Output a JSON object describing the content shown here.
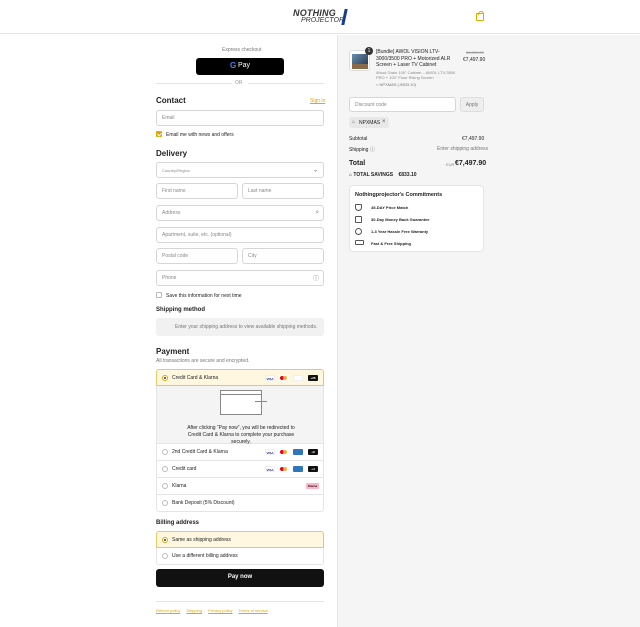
{
  "header": {
    "logo_line1": "NOTHING",
    "logo_line2": "PROJECTOR",
    "bag_icon": "shopping-bag-icon"
  },
  "express": {
    "title": "Express checkout",
    "gpay_g": "G",
    "gpay_label": "Pay",
    "or": "OR"
  },
  "contact": {
    "title": "Contact",
    "sign_in": "Sign in",
    "email_placeholder": "Email",
    "newsletter_label": "Email me with news and offers",
    "newsletter_checked": true
  },
  "delivery": {
    "title": "Delivery",
    "country_placeholder": "Country/Region",
    "first_name": "First name",
    "last_name": "Last name",
    "address": "Address",
    "apartment": "Apartment, suite, etc. (optional)",
    "postal": "Postal code",
    "city": "City",
    "phone": "Phone",
    "save_info": "Save this information for next time"
  },
  "shipping": {
    "title": "Shipping method",
    "message": "Enter your shipping address to view available shipping methods."
  },
  "payment": {
    "title": "Payment",
    "subtitle": "All transactions are secure and encrypted.",
    "options": [
      {
        "label": "Credit Card & Klarna",
        "selected": true
      },
      {
        "label": "2nd Credit Card & Klarna",
        "selected": false
      },
      {
        "label": "Credit card",
        "selected": false
      },
      {
        "label": "Klarna",
        "selected": false
      },
      {
        "label": "Bank Deposit (5% Discount)",
        "selected": false
      }
    ],
    "redirect_text": "After clicking “Pay now”, you will be redirected to Credit Card & Klarna to complete your purchase securely.",
    "badges": {
      "visa": "VISA",
      "more1": "+26",
      "more2": "+8",
      "more3": "+4",
      "klarna": "Klarna"
    }
  },
  "billing": {
    "title": "Billing address",
    "options": [
      {
        "label": "Same as shipping address",
        "selected": true
      },
      {
        "label": "Use a different billing address",
        "selected": false
      }
    ]
  },
  "pay_now": "Pay now",
  "footer_links": [
    "Refund policy",
    "Shipping",
    "Privacy policy",
    "Terms of service"
  ],
  "summary": {
    "qty_badge": "1",
    "product_title": "[Bundle] AWOL VISION LTV-3000/3500 PRO + Motorized ALR Screen + Laser TV Cabinet",
    "product_variant": "Wood Grain 100\" Cabinet – AWOL LTV-3500 PRO + 100\" Floor Rising Screen",
    "product_discount": "NPXMAS (-€833.10)",
    "price_original": "€8,331.00",
    "price": "€7,497.90",
    "discount_placeholder": "Discount code",
    "apply": "Apply",
    "applied_code": "NPXMAS",
    "subtotal_label": "Subtotal",
    "subtotal_value": "€7,497.90",
    "shipping_label": "Shipping",
    "shipping_value": "Enter shipping address",
    "total_label": "Total",
    "currency": "EUR",
    "total_value": "€7,497.90",
    "savings_label": "TOTAL SAVINGS",
    "savings_value": "€833.10"
  },
  "commitments": {
    "title": "Nothingprojector's Commitments",
    "items": [
      {
        "icon": "shield-check-icon",
        "label": "45-DAY Price Match"
      },
      {
        "icon": "calendar-icon",
        "label": "30-Day Money Back Guarantee"
      },
      {
        "icon": "warranty-icon",
        "label": "1-3 Year Hassle Free Warranty"
      },
      {
        "icon": "truck-icon",
        "label": "Fast & Free Shipping"
      }
    ]
  }
}
